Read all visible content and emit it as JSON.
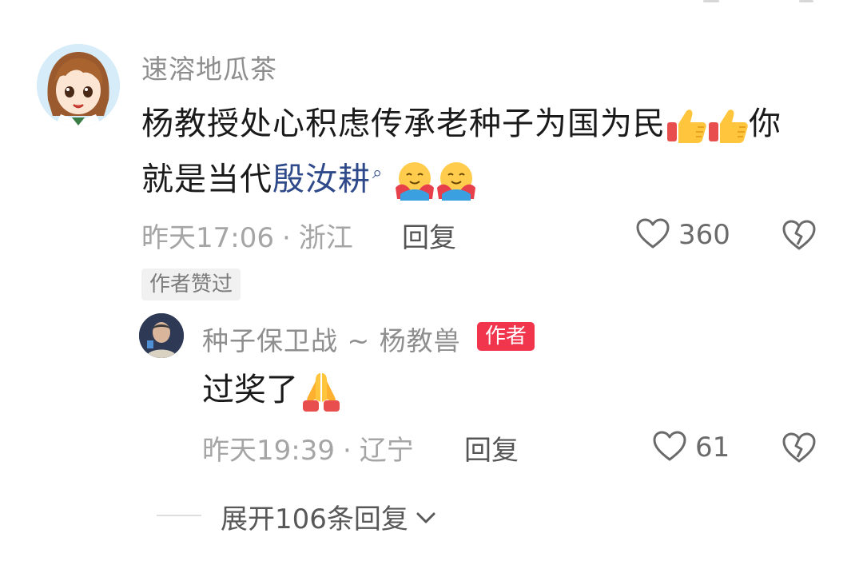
{
  "main_comment": {
    "username": "速溶地瓜茶",
    "text_line1": "杨教授处心积虑传承老种子为国为民",
    "text_after_emoji": "你",
    "text_line2_prefix": "就是当代",
    "link_text": "殷汝耕",
    "link_icon": "search-icon",
    "emoji_1": "thumbs-up-icon",
    "emoji_2": "hugging-face-icon",
    "time": "昨天17:06",
    "separator": "·",
    "location": "浙江",
    "reply_label": "回复",
    "likes": "360",
    "author_liked_label": "作者赞过"
  },
  "reply_comment": {
    "username": "种子保卫战 ~ 杨教兽",
    "author_badge": "作者",
    "text": "过奖了",
    "emoji": "folded-hands-icon",
    "time": "昨天19:39",
    "separator": "·",
    "location": "辽宁",
    "reply_label": "回复",
    "likes": "61"
  },
  "expand": {
    "label": "展开106条回复"
  },
  "colors": {
    "link": "#2f4a8a",
    "author_badge": "#f0354d",
    "meta_text": "#a5a5a5"
  }
}
